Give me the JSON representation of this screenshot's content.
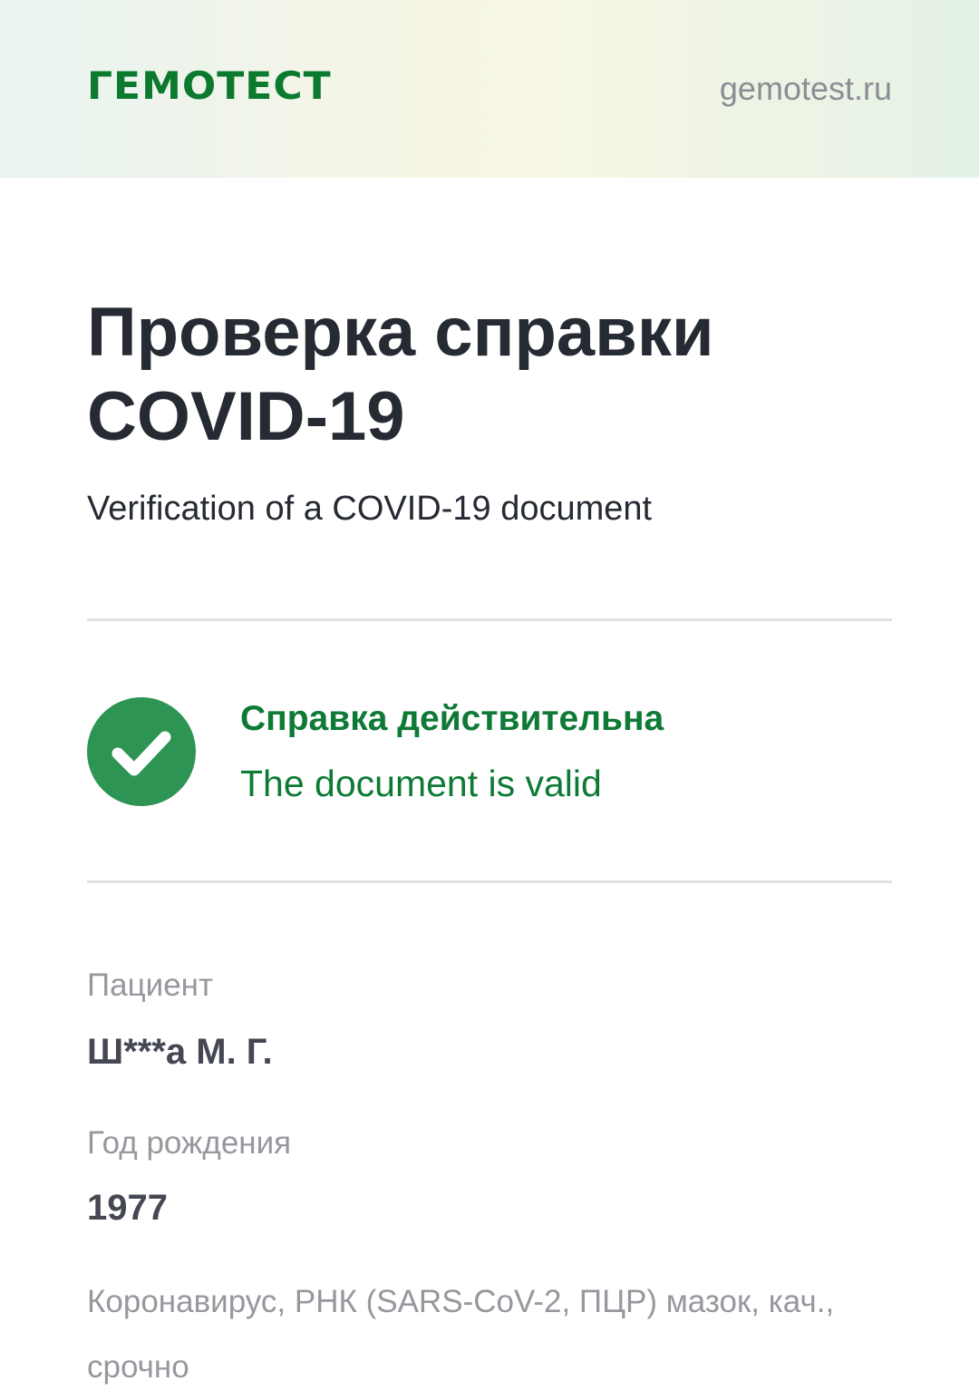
{
  "header": {
    "logo_text": "ГЕМОТЕСТ",
    "site_link": "gemotest.ru"
  },
  "page": {
    "title": "Проверка справки COVID-19",
    "subtitle": "Verification of a COVID-19 document"
  },
  "status": {
    "icon": "check-circle-icon",
    "title": "Справка действительна",
    "subtitle": "The document is valid",
    "color": "#2e9454"
  },
  "patient": {
    "label": "Пациент",
    "value": "Ш***а М. Г."
  },
  "birth_year": {
    "label": "Год рождения",
    "value": "1977"
  },
  "test": {
    "name": "Коронавирус, РНК (SARS-CoV-2, ПЦР) мазок, кач., срочно"
  },
  "colors": {
    "brand": "#0b7a2f",
    "text": "#262a33",
    "muted": "#96989e"
  }
}
